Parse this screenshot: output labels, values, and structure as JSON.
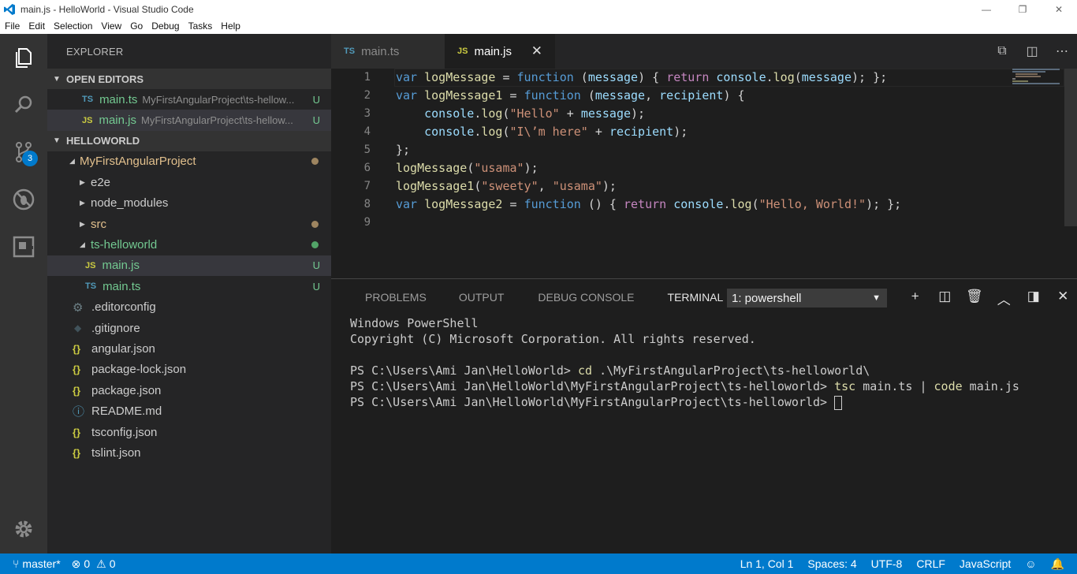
{
  "window": {
    "title": "main.js - HelloWorld - Visual Studio Code",
    "minimize": "—",
    "maximize": "❐",
    "close": "✕"
  },
  "menu": [
    "File",
    "Edit",
    "Selection",
    "View",
    "Go",
    "Debug",
    "Tasks",
    "Help"
  ],
  "activity": {
    "items": [
      "files-icon",
      "search-icon",
      "source-control-icon",
      "debug-icon",
      "extensions-icon"
    ],
    "scm_badge": "3",
    "settings": "gear-icon"
  },
  "sidebar": {
    "title": "EXPLORER",
    "open_editors": {
      "header": "OPEN EDITORS",
      "items": [
        {
          "type": "TS",
          "name": "main.ts",
          "path": "MyFirstAngularProject\\ts-hellow...",
          "status": "U"
        },
        {
          "type": "JS",
          "name": "main.js",
          "path": "MyFirstAngularProject\\ts-hellow...",
          "status": "U"
        }
      ]
    },
    "workspace": {
      "header": "HELLOWORLD",
      "project": "MyFirstAngularProject",
      "folders": [
        "e2e",
        "node_modules",
        "src",
        "ts-helloworld"
      ],
      "children": [
        {
          "type": "JS",
          "name": "main.js",
          "status": "U"
        },
        {
          "type": "TS",
          "name": "main.ts",
          "status": "U"
        }
      ],
      "files": [
        {
          "icon": "gear-icon",
          "glyph": "⚙",
          "name": ".editorconfig"
        },
        {
          "icon": "diamond-icon",
          "glyph": "◆",
          "name": ".gitignore"
        },
        {
          "icon": "braces-icon",
          "glyph": "{}",
          "name": "angular.json"
        },
        {
          "icon": "braces-icon",
          "glyph": "{}",
          "name": "package-lock.json"
        },
        {
          "icon": "braces-icon",
          "glyph": "{}",
          "name": "package.json"
        },
        {
          "icon": "info-icon",
          "glyph": "ⓘ",
          "name": "README.md"
        },
        {
          "icon": "braces-icon",
          "glyph": "{}",
          "name": "tsconfig.json"
        },
        {
          "icon": "braces-icon",
          "glyph": "{}",
          "name": "tslint.json"
        }
      ]
    }
  },
  "tabs": [
    {
      "type": "TS",
      "label": "main.ts"
    },
    {
      "type": "JS",
      "label": "main.js",
      "close": "✕"
    }
  ],
  "editor": {
    "line_numbers": [
      "1",
      "2",
      "3",
      "4",
      "5",
      "6",
      "7",
      "8",
      "9"
    ]
  },
  "panel": {
    "tabs": [
      "PROBLEMS",
      "OUTPUT",
      "DEBUG CONSOLE",
      "TERMINAL"
    ],
    "terminal_select": "1: powershell",
    "terminal": {
      "l1": "Windows PowerShell",
      "l2": "Copyright (C) Microsoft Corporation. All rights reserved.",
      "l4_prompt": "PS C:\\Users\\Ami Jan\\HelloWorld>",
      "l4_cmd": "cd",
      "l4_rest": " .\\MyFirstAngularProject\\ts-helloworld\\",
      "l5_prompt": "PS C:\\Users\\Ami Jan\\HelloWorld\\MyFirstAngularProject\\ts-helloworld>",
      "l5_cmd1": "tsc",
      "l5_arg1": " main.ts | ",
      "l5_cmd2": "code",
      "l5_arg2": " main.js",
      "l6_prompt": "PS C:\\Users\\Ami Jan\\HelloWorld\\MyFirstAngularProject\\ts-helloworld>"
    }
  },
  "statusbar": {
    "branch": "master*",
    "errors": "0",
    "warnings": "0",
    "position": "Ln 1, Col 1",
    "spaces": "Spaces: 4",
    "encoding": "UTF-8",
    "eol": "CRLF",
    "language": "JavaScript"
  }
}
